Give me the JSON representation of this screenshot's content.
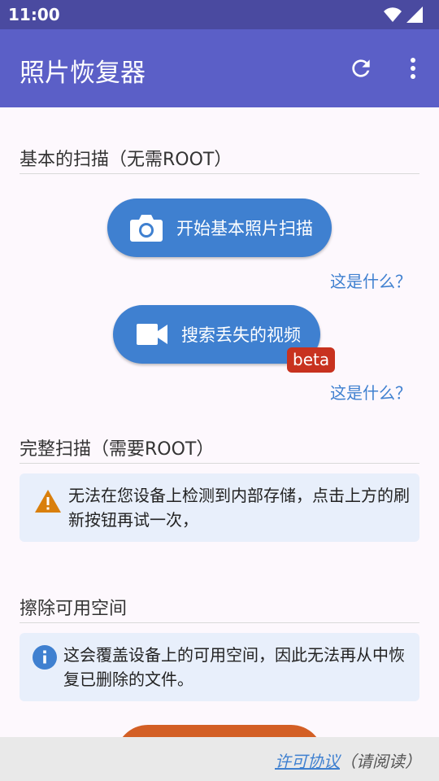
{
  "status_bar": {
    "time": "11:00"
  },
  "app_bar": {
    "title": "照片恢复器"
  },
  "basic_scan": {
    "title": "基本的扫描（无需ROOT）",
    "photo_scan_label": "开始基本照片扫描",
    "photo_help": "这是什么？",
    "video_search_label": "搜索丢失的视频",
    "video_badge": "beta",
    "video_help": "这是什么？"
  },
  "full_scan": {
    "title": "完整扫描（需要ROOT）",
    "warning": "无法在您设备上检测到内部存储，点击上方的刷新按钮再试一次，"
  },
  "wipe": {
    "title": "擦除可用空间",
    "info": "这会覆盖设备上的可用空间，因此无法再从中恢复已删除的文件。"
  },
  "footer": {
    "license_link": "许可协议",
    "note": "（请阅读）"
  },
  "colors": {
    "accent": "#3f80d0",
    "app_bar": "#5b5fc7",
    "status_bar": "#4a4aa0",
    "badge": "#c8321f",
    "warning": "#d97f0c",
    "orange_button": "#d35f25"
  },
  "icons": [
    "wifi-icon",
    "cellular-icon",
    "refresh-icon",
    "more-vert-icon",
    "camera-icon",
    "video-camera-icon",
    "warning-icon",
    "info-icon"
  ]
}
